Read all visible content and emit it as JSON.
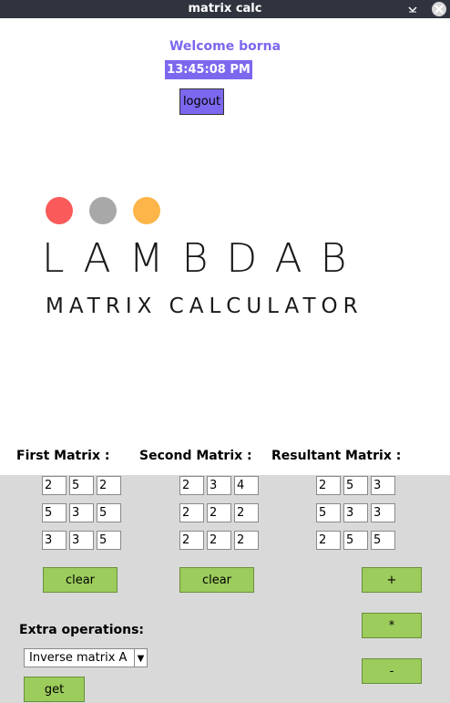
{
  "window": {
    "title": "matrix calc"
  },
  "header": {
    "welcome": "Welcome borna",
    "clock": "13:45:08 PM",
    "logout_label": "logout"
  },
  "logo": {
    "title": "LAMBDAB",
    "subtitle": "MATRIX CALCULATOR",
    "dots": [
      "#fa5a5a",
      "#a8a8a8",
      "#fdb549"
    ]
  },
  "labels": {
    "first": "First Matrix :",
    "second": "Second Matrix :",
    "result": "Resultant Matrix :"
  },
  "matrices": {
    "first": [
      [
        "2",
        "5",
        "2"
      ],
      [
        "5",
        "3",
        "5"
      ],
      [
        "3",
        "3",
        "5"
      ]
    ],
    "second": [
      [
        "2",
        "3",
        "4"
      ],
      [
        "2",
        "2",
        "2"
      ],
      [
        "2",
        "2",
        "2"
      ]
    ],
    "result": [
      [
        "2",
        "5",
        "3"
      ],
      [
        "5",
        "3",
        "3"
      ],
      [
        "2",
        "5",
        "5"
      ]
    ]
  },
  "buttons": {
    "clear_first": "clear",
    "clear_second": "clear",
    "add": "+",
    "multiply": "*",
    "subtract": "-",
    "get": "get"
  },
  "extra": {
    "label": "Extra operations:",
    "selected": "Inverse matrix A"
  },
  "colors": {
    "accent": "#7b68ee",
    "button_green": "#9ccc5c",
    "titlebar": "#2f343f",
    "panel": "#d9d9d9"
  }
}
